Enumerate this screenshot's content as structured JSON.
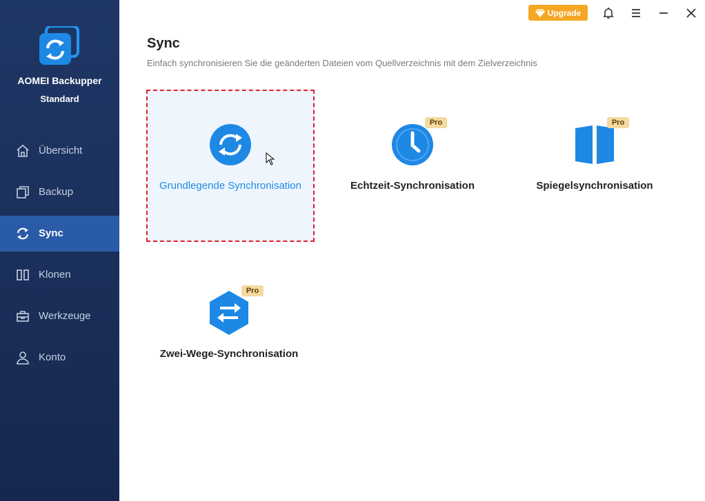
{
  "app": {
    "name": "AOMEI Backupper",
    "edition": "Standard"
  },
  "sidebar": {
    "items": [
      {
        "label": "Übersicht",
        "icon": "home-icon"
      },
      {
        "label": "Backup",
        "icon": "copy-icon"
      },
      {
        "label": "Sync",
        "icon": "sync-icon",
        "active": true
      },
      {
        "label": "Klonen",
        "icon": "clone-icon"
      },
      {
        "label": "Werkzeuge",
        "icon": "toolbox-icon"
      },
      {
        "label": "Konto",
        "icon": "user-icon"
      }
    ]
  },
  "topbar": {
    "upgrade_label": "Upgrade"
  },
  "page": {
    "title": "Sync",
    "subtitle": "Einfach synchronisieren Sie die geänderten Dateien vom Quellverzeichnis mit dem Zielverzeichnis"
  },
  "options": [
    {
      "label": "Grundlegende Synchronisation",
      "icon": "sync-circle-icon",
      "pro": false,
      "selected": true
    },
    {
      "label": "Echtzeit-Synchronisation",
      "icon": "clock-icon",
      "pro": true,
      "pro_label": "Pro"
    },
    {
      "label": "Spiegelsynchronisation",
      "icon": "mirror-icon",
      "pro": true,
      "pro_label": "Pro"
    },
    {
      "label": "Zwei-Wege-Synchronisation",
      "icon": "two-way-arrows-icon",
      "pro": true,
      "pro_label": "Pro"
    }
  ],
  "colors": {
    "sidebar": "#1f3766",
    "active": "#2a5ba8",
    "accent": "#1f8ce6",
    "upgrade": "#f5a623",
    "selection_border": "#e01e28"
  }
}
